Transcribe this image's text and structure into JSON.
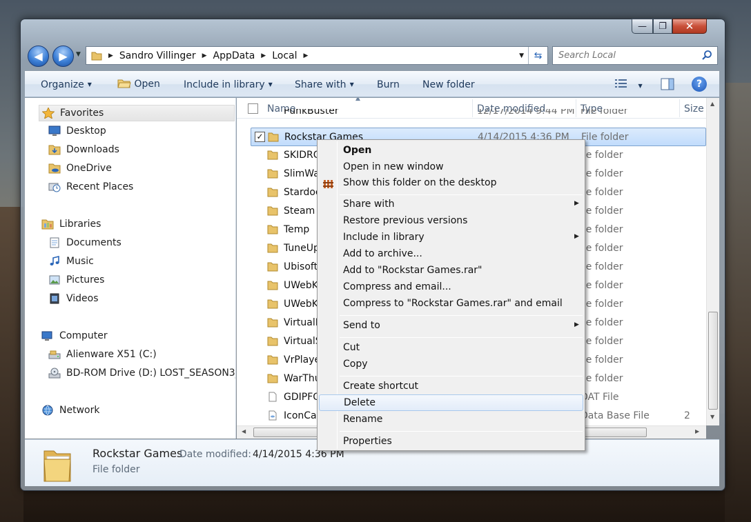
{
  "window": {
    "caption": {
      "minimize": "—",
      "maximize": "❐",
      "close": "✕"
    }
  },
  "nav": {
    "back": "◀",
    "forward": "▶",
    "breadcrumbs": [
      "Sandro Villinger",
      "AppData",
      "Local"
    ],
    "search_placeholder": "Search Local"
  },
  "toolbar": {
    "organize": "Organize",
    "open": "Open",
    "include_in_library": "Include in library",
    "share_with": "Share with",
    "burn": "Burn",
    "new_folder": "New folder",
    "help": "?"
  },
  "sidebar": {
    "favorites": "Favorites",
    "fav_items": [
      "Desktop",
      "Downloads",
      "OneDrive",
      "Recent Places"
    ],
    "libraries": "Libraries",
    "lib_items": [
      "Documents",
      "Music",
      "Pictures",
      "Videos"
    ],
    "computer": "Computer",
    "comp_items": [
      "Alienware X51 (C:)",
      "BD-ROM Drive (D:) LOST_SEASON3_D"
    ],
    "network": "Network"
  },
  "filelist": {
    "columns": {
      "name": "Name",
      "date": "Date modified",
      "type": "Type",
      "size": "Size"
    },
    "rows": [
      {
        "name": "PunkBuster",
        "date": "12/17/2014 9:44 PM",
        "type": "File folder",
        "size": ""
      },
      {
        "name": "Rockstar Games",
        "date": "4/14/2015 4:36 PM",
        "type": "File folder",
        "size": "",
        "selected": true
      },
      {
        "name": "SKIDRO",
        "date": "",
        "type": "ile folder",
        "size": ""
      },
      {
        "name": "SlimWa",
        "date": "",
        "type": "ile folder",
        "size": ""
      },
      {
        "name": "Stardoc",
        "date": "",
        "type": "ile folder",
        "size": ""
      },
      {
        "name": "Steam",
        "date": "",
        "type": "ile folder",
        "size": ""
      },
      {
        "name": "Temp",
        "date": "",
        "type": "ile folder",
        "size": ""
      },
      {
        "name": "TuneUp",
        "date": "",
        "type": "ile folder",
        "size": ""
      },
      {
        "name": "Ubisoft",
        "date": "",
        "type": "ile folder",
        "size": ""
      },
      {
        "name": "UWebK",
        "date": "",
        "type": "ile folder",
        "size": ""
      },
      {
        "name": "UWebK",
        "date": "",
        "type": "ile folder",
        "size": ""
      },
      {
        "name": "VirtualF",
        "date": "",
        "type": "ile folder",
        "size": ""
      },
      {
        "name": "VirtualS",
        "date": "",
        "type": "ile folder",
        "size": ""
      },
      {
        "name": "VrPlaye",
        "date": "",
        "type": "ile folder",
        "size": ""
      },
      {
        "name": "WarThu",
        "date": "",
        "type": "ile folder",
        "size": ""
      },
      {
        "name": "GDIPFO",
        "date": "",
        "type": "DAT File",
        "size": ""
      },
      {
        "name": "IconCac",
        "date": "",
        "type": "Data Base File",
        "size": "2"
      }
    ]
  },
  "details": {
    "name": "Rockstar Games",
    "date_label": "Date modified:",
    "date_value": "4/14/2015 4:36 PM",
    "type": "File folder"
  },
  "context_menu": {
    "items": [
      "Open",
      "Open in new window",
      "Show this folder on the desktop",
      "Share with",
      "Restore previous versions",
      "Include in library",
      "Add to archive...",
      "Add to \"Rockstar Games.rar\"",
      "Compress and email...",
      "Compress to \"Rockstar Games.rar\" and email",
      "Send to",
      "Cut",
      "Copy",
      "Create shortcut",
      "Delete",
      "Rename",
      "Properties"
    ],
    "highlighted": "Delete"
  },
  "colors": {
    "accent": "#3c7fd6",
    "selection": "#c1dcfc",
    "command_text": "#1e395b"
  }
}
